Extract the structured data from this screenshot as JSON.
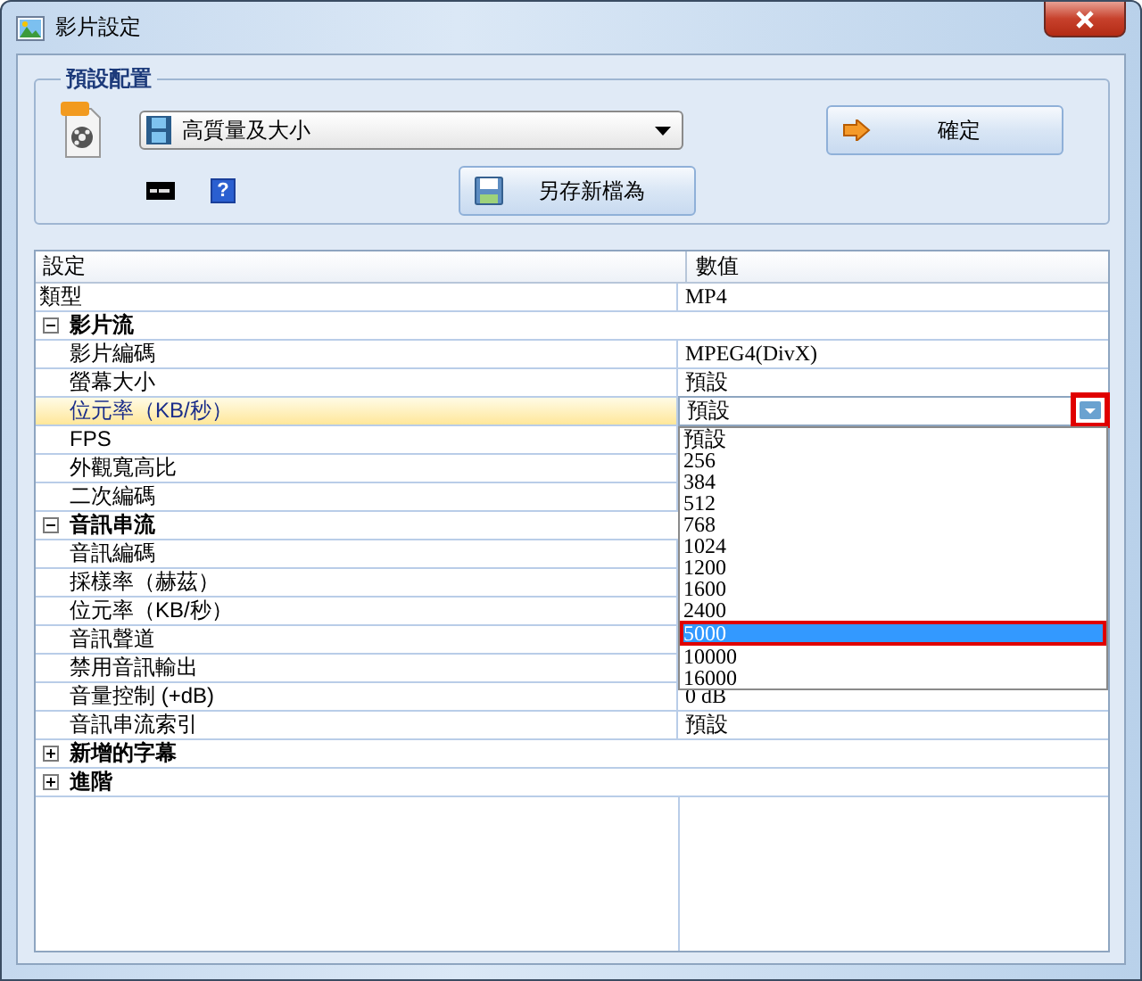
{
  "window": {
    "title": "影片設定"
  },
  "preset": {
    "legend": "預設配置",
    "combo_value": "高質量及大小",
    "help_label": "?",
    "ok_button": "確定",
    "save_as_button": "另存新檔為"
  },
  "table": {
    "columns": [
      "設定",
      "數值"
    ],
    "rows": [
      {
        "kind": "row",
        "label": "類型",
        "value": "MP4"
      },
      {
        "kind": "group",
        "label": "影片流",
        "expanded": true,
        "children": [
          {
            "label": "影片編碼",
            "value": "MPEG4(DivX)"
          },
          {
            "label": "螢幕大小",
            "value": "預設"
          },
          {
            "label": "位元率（KB/秒）",
            "value": "預設",
            "selected": true,
            "dropdown": {
              "button_marked": true,
              "options": [
                {
                  "label": "預設",
                  "selected": false
                },
                {
                  "label": "256",
                  "selected": false
                },
                {
                  "label": "384",
                  "selected": false
                },
                {
                  "label": "512",
                  "selected": false
                },
                {
                  "label": "768",
                  "selected": false
                },
                {
                  "label": "1024",
                  "selected": false
                },
                {
                  "label": "1200",
                  "selected": false
                },
                {
                  "label": "1600",
                  "selected": false
                },
                {
                  "label": "2400",
                  "selected": false
                },
                {
                  "label": "5000",
                  "selected": true
                },
                {
                  "label": "10000",
                  "selected": false
                },
                {
                  "label": "16000",
                  "selected": false
                }
              ]
            }
          },
          {
            "label": "FPS",
            "selected": false
          },
          {
            "label": "外觀寬高比",
            "selected": false
          },
          {
            "label": "二次編碼",
            "selected": false
          }
        ]
      },
      {
        "kind": "group",
        "label": "音訊串流",
        "expanded": true,
        "children": [
          {
            "label": "音訊編碼",
            "selected": false
          },
          {
            "label": "採樣率（赫茲）",
            "selected": false
          },
          {
            "label": "位元率（KB/秒）",
            "selected": false
          },
          {
            "label": "音訊聲道",
            "selected": false
          },
          {
            "label": "禁用音訊輸出",
            "selected": false
          },
          {
            "label": "音量控制 (+dB)",
            "value": "0 dB",
            "selected": false
          },
          {
            "label": "音訊串流索引",
            "value": "預設",
            "selected": false
          }
        ]
      },
      {
        "kind": "group",
        "label": "新增的字幕",
        "expanded": false
      },
      {
        "kind": "group",
        "label": "進階",
        "expanded": false
      }
    ]
  }
}
